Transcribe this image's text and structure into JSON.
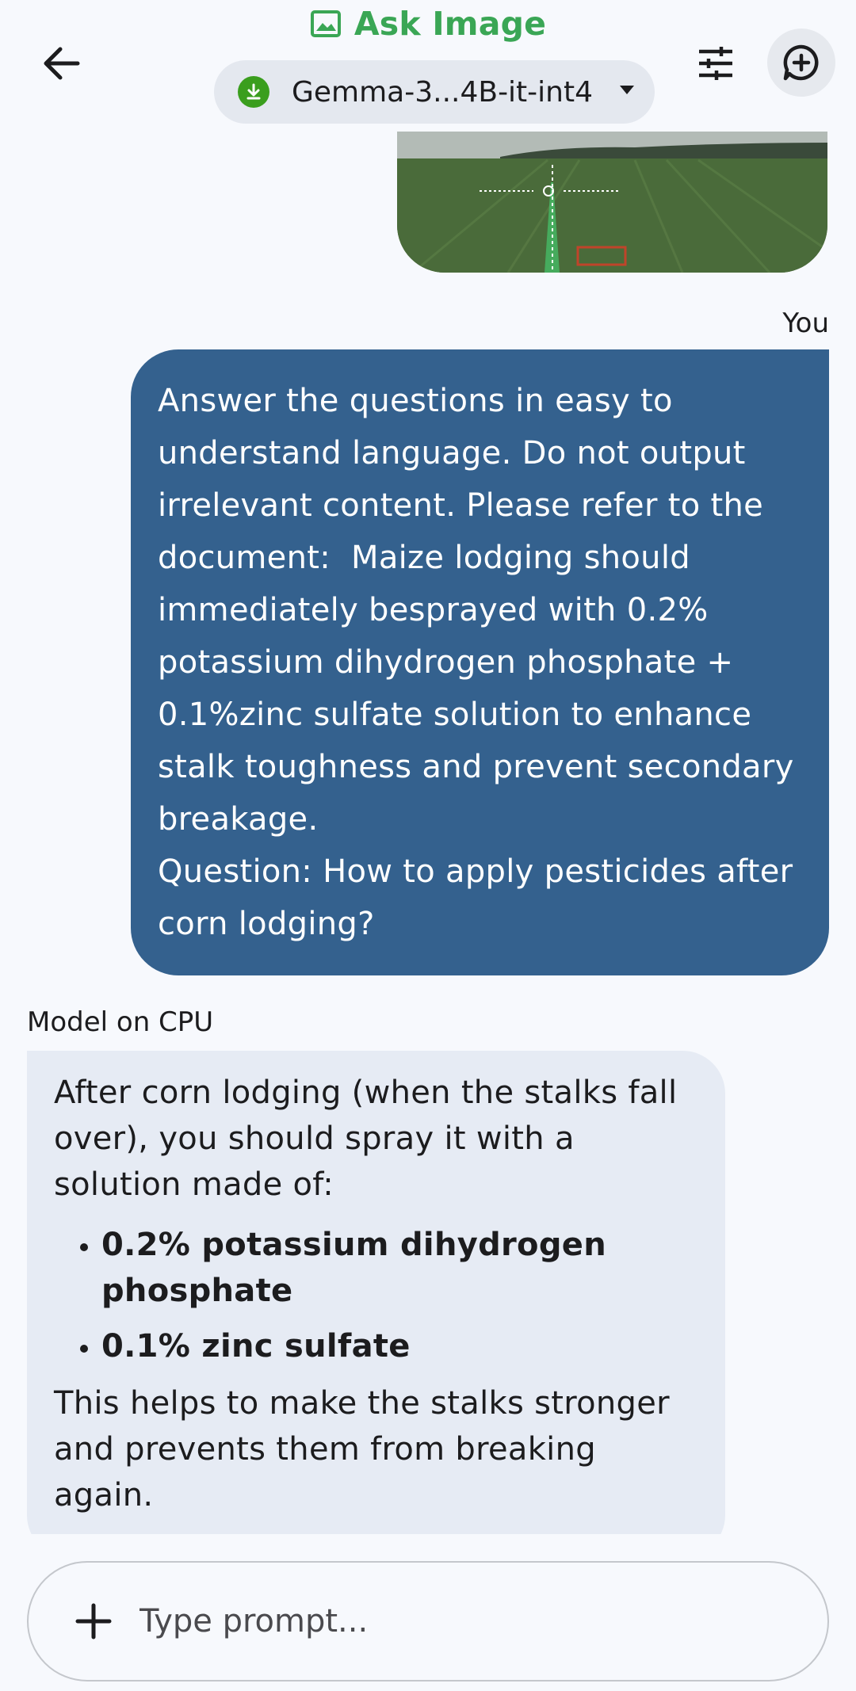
{
  "header": {
    "title": "Ask Image",
    "model_name": "Gemma-3...4B-it-int4",
    "icons": {
      "back": "arrow-left-icon",
      "title": "image-icon",
      "model_status": "download-icon",
      "dropdown": "chevron-down-icon",
      "settings": "tune-icon",
      "new_chat": "chat-add-icon"
    }
  },
  "chat": {
    "user_sender": "You",
    "user_message": "Answer the questions in easy to understand language. Do not output irrelevant content. Please refer to the document:  Maize lodging should immediately besprayed with 0.2% potassium dihydrogen phosphate + 0.1%zinc sulfate solution to enhance stalk toughness and prevent secondary breakage.\nQuestion: How to apply pesticides after corn lodging?",
    "model_sender": "Model on CPU",
    "model_intro": "After corn lodging (when the stalks fall over), you should spray it with a solution made of:",
    "model_bullets": [
      "0.2% potassium dihydrogen phosphate",
      "0.1% zinc sulfate"
    ],
    "model_outro": "This helps to make the stalks stronger and prevents them from breaking again."
  },
  "input": {
    "placeholder": "Type prompt...",
    "value": "",
    "add_icon": "plus-icon"
  },
  "colors": {
    "title_green": "#3aa655",
    "user_bubble": "#34618e",
    "model_bubble": "#e6ebf4",
    "background": "#f7f9fd"
  }
}
